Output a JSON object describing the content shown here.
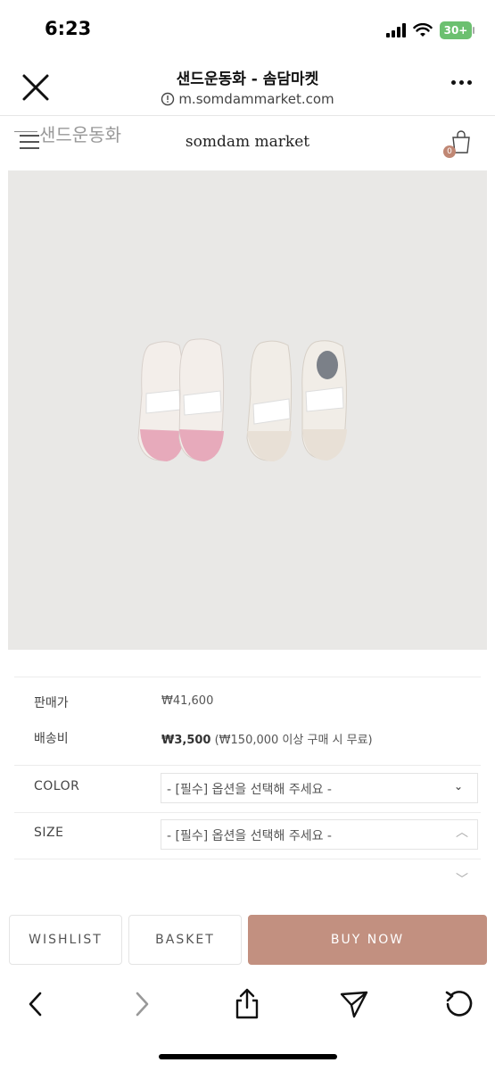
{
  "status_bar": {
    "time": "6:23",
    "battery": "30+"
  },
  "browser": {
    "page_title": "샌드운동화 - 솜담마켓",
    "url": "m.somdammarket.com"
  },
  "site": {
    "ghost_title": "샌드운동화",
    "logo": "somdam market",
    "cart_count": "0"
  },
  "product": {
    "image_icon": "sneakers-photo"
  },
  "info": {
    "price_label": "판매가",
    "price_value": "₩41,600",
    "shipping_label": "배송비",
    "shipping_value": "₩3,500",
    "shipping_note": "(₩150,000 이상 구매 시 무료)"
  },
  "options": {
    "color_label": "COLOR",
    "color_value": "- [필수] 옵션을 선택해 주세요 -",
    "size_label": "SIZE",
    "size_value": "- [필수] 옵션을 선택해 주세요 -"
  },
  "actions": {
    "wishlist": "WISHLIST",
    "basket": "BASKET",
    "buy_now": "BUY NOW"
  },
  "colors": {
    "accent": "#c29080",
    "image_bg": "#e9e8e6",
    "battery": "#6cc070"
  }
}
